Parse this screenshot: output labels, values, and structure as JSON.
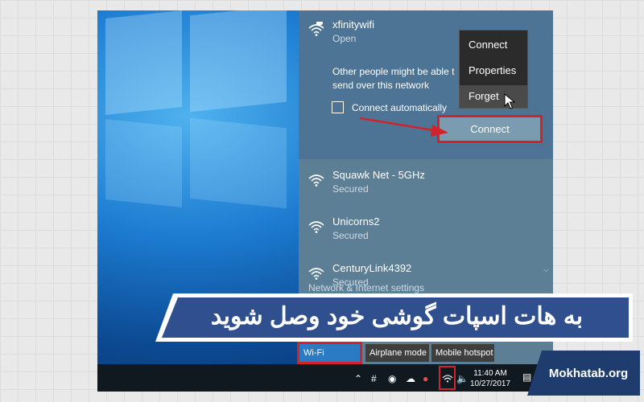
{
  "current_network": {
    "name": "xfinitywifi",
    "status": "Open",
    "warning": "Other people might be able t send over this network",
    "checkbox_label": "Connect automatically",
    "connect_button": "Connect"
  },
  "context_menu": {
    "items": [
      "Connect",
      "Properties",
      "Forget"
    ]
  },
  "networks": [
    {
      "name": "Squawk Net - 5GHz",
      "status": "Secured"
    },
    {
      "name": "Unicorns2",
      "status": "Secured"
    },
    {
      "name": "CenturyLink4392",
      "status": "Secured"
    }
  ],
  "settings_link": "Network & Internet settings",
  "quick_actions": [
    "Wi-Fi",
    "Airplane mode",
    "Mobile hotspot"
  ],
  "taskbar": {
    "time": "11:40 AM",
    "date": "10/27/2017"
  },
  "overlay": {
    "banner": "به هات اسپات گوشی خود وصل شوید",
    "brand": "Mokhatab.org"
  },
  "colors": {
    "highlight_red": "#d2232a",
    "banner_blue": "#2f4f8f",
    "brand_navy": "#1f3c6e"
  }
}
